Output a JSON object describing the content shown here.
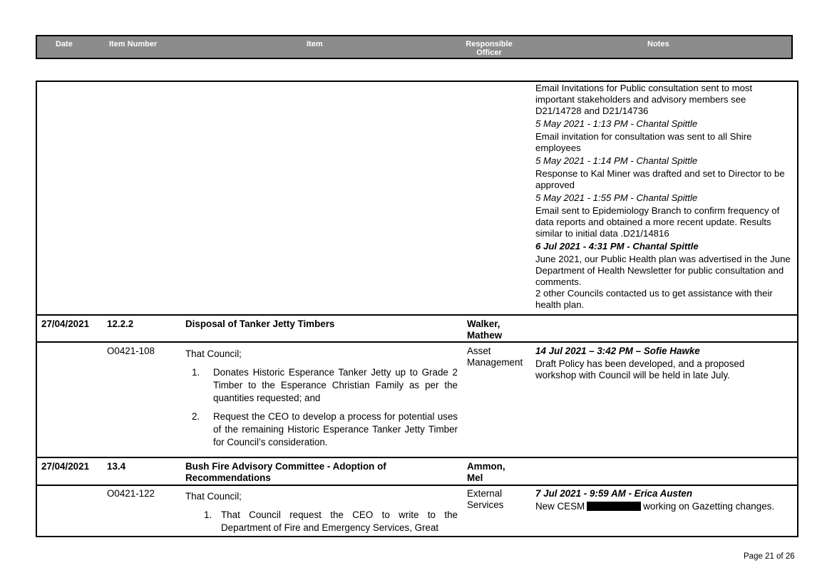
{
  "header": {
    "date": "Date",
    "item_number": "Item Number",
    "item": "Item",
    "responsible_officer": "Responsible Officer",
    "notes": "Notes"
  },
  "continued_notes": [
    {
      "type": "text",
      "text": "Email Invitations for Public consultation sent to most important stakeholders and advisory members see D21/14728 and D21/14736"
    },
    {
      "type": "stamp",
      "text": "5 May 2021 - 1:13 PM - Chantal Spittle"
    },
    {
      "type": "text",
      "text": "Email invitation for consultation was sent to all Shire employees"
    },
    {
      "type": "stamp",
      "text": "5 May 2021 - 1:14 PM - Chantal Spittle"
    },
    {
      "type": "text",
      "text": "Response to Kal Miner was drafted and set to Director to be approved"
    },
    {
      "type": "stamp",
      "text": "5 May 2021 - 1:55 PM - Chantal Spittle"
    },
    {
      "type": "text",
      "text": "Email sent to Epidemiology Branch to confirm frequency of data reports and obtained a more recent update. Results similar  to initial data .D21/14816"
    },
    {
      "type": "stamp_bold",
      "text": "6 Jul 2021 - 4:31 PM - Chantal Spittle"
    },
    {
      "type": "text",
      "text": "June 2021, our Public Health plan was advertised in the June Department of Health Newsletter for public consultation and comments."
    },
    {
      "type": "text",
      "text": "2 other Councils contacted us to get assistance with their health plan."
    }
  ],
  "items": [
    {
      "date": "27/04/2021",
      "number": "12.2.2",
      "title": "Disposal of Tanker Jetty Timbers",
      "officer": "Walker, Mathew",
      "resolution": {
        "number": "O0421-108",
        "intro": "That Council;",
        "points": [
          {
            "num": "1.",
            "text": "Donates Historic Esperance Tanker Jetty up to Grade 2 Timber to the Esperance Christian Family as per the quantities requested; and"
          },
          {
            "num": "2.",
            "text": "Request the CEO to develop a process for potential uses of the remaining Historic Esperance Tanker Jetty Timber for Council’s consideration."
          }
        ],
        "department": "Asset Management",
        "note_stamp": "14 Jul 2021 – 3:42 PM – Sofie Hawke",
        "note_text": "Draft Policy has been developed, and a proposed workshop with Council will be held in late July."
      }
    },
    {
      "date": "27/04/2021",
      "number": "13.4",
      "title": "Bush Fire Advisory Committee - Adoption of Recommendations",
      "officer": "Ammon, Mel",
      "resolution": {
        "number": "O0421-122",
        "intro": "That Council;",
        "points": [
          {
            "num": "1.",
            "text": "That Council request the CEO to write to the Department of Fire and Emergency Services, Great"
          }
        ],
        "department": "External Services",
        "note_stamp": "7 Jul 2021 - 9:59 AM - Erica Austen",
        "note_text_before": "New CESM",
        "note_text_after": "working on Gazetting changes."
      }
    }
  ],
  "footer": {
    "page": "Page 21 of 26"
  }
}
